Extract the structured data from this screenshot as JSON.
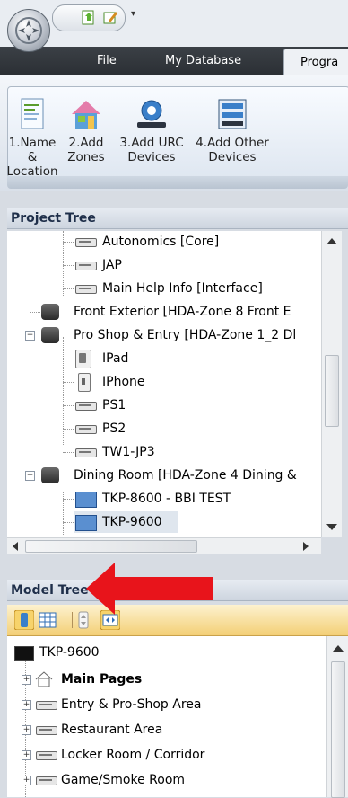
{
  "ribbon": {
    "tabs": [
      "File",
      "My Database",
      "Progra"
    ],
    "buttons": [
      {
        "line1": "1.Name &",
        "line2": "Location",
        "icon": "document-icon"
      },
      {
        "line1": "2.Add",
        "line2": "Zones",
        "icon": "house-icon"
      },
      {
        "line1": "3.Add URC",
        "line2": "Devices",
        "icon": "urc-device-icon"
      },
      {
        "line1": "4.Add Other",
        "line2": "Devices",
        "icon": "rack-device-icon"
      }
    ]
  },
  "project_tree": {
    "title": "Project Tree",
    "items": [
      {
        "label": "Autonomics [Core]",
        "icon": "remote-icon"
      },
      {
        "label": "JAP",
        "icon": "remote-icon"
      },
      {
        "label": "Main Help Info [Interface]",
        "icon": "remote-icon"
      },
      {
        "label": "Front Exterior [HDA-Zone 8 Front E",
        "icon": "room-icon"
      },
      {
        "label": "Pro Shop & Entry [HDA-Zone 1_2 Dl",
        "icon": "room-icon",
        "expanded": true
      },
      {
        "label": "IPad",
        "icon": "ipad-icon"
      },
      {
        "label": "IPhone",
        "icon": "iphone-icon"
      },
      {
        "label": "PS1",
        "icon": "remote-icon"
      },
      {
        "label": "PS2",
        "icon": "remote-icon"
      },
      {
        "label": "TW1-JP3",
        "icon": "remote-icon"
      },
      {
        "label": "Dining Room [HDA-Zone 4  Dining &",
        "icon": "room-icon",
        "expanded": true
      },
      {
        "label": "TKP-8600 - BBI TEST",
        "icon": "tkp-icon"
      },
      {
        "label": "TKP-9600",
        "icon": "tkp-icon",
        "selected": true
      }
    ]
  },
  "model_tree": {
    "title": "Model Tree",
    "root": "TKP-9600",
    "items": [
      {
        "label": "Main Pages",
        "bold": true,
        "icon": "home-icon"
      },
      {
        "label": "Entry & Pro-Shop Area",
        "icon": "remote-icon"
      },
      {
        "label": "Restaurant Area",
        "icon": "remote-icon"
      },
      {
        "label": "Locker Room / Corridor",
        "icon": "remote-icon"
      },
      {
        "label": "Game/Smoke Room",
        "icon": "remote-icon"
      }
    ]
  },
  "colors": {
    "accent_red": "#e8141b",
    "selection": "#dfe6ee",
    "toolbar_gold": "#f3cf76"
  }
}
